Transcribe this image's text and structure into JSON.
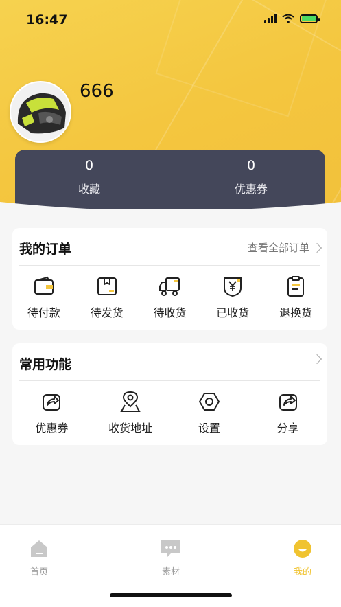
{
  "status_bar": {
    "time": "16:47"
  },
  "profile": {
    "username": "666"
  },
  "stats": [
    {
      "value": "0",
      "label": "收藏"
    },
    {
      "value": "0",
      "label": "优惠券"
    }
  ],
  "orders": {
    "title": "我的订单",
    "view_all": "查看全部订单",
    "items": [
      {
        "label": "待付款",
        "icon": "wallet-icon"
      },
      {
        "label": "待发货",
        "icon": "package-icon"
      },
      {
        "label": "待收货",
        "icon": "truck-icon"
      },
      {
        "label": "已收货",
        "icon": "yen-shield-icon"
      },
      {
        "label": "退换货",
        "icon": "clipboard-icon"
      }
    ]
  },
  "functions": {
    "title": "常用功能",
    "items": [
      {
        "label": "优惠券",
        "icon": "share-icon"
      },
      {
        "label": "收货地址",
        "icon": "location-pin-icon"
      },
      {
        "label": "设置",
        "icon": "settings-hexagon-icon"
      },
      {
        "label": "分享",
        "icon": "share-icon"
      }
    ]
  },
  "tabbar": {
    "items": [
      {
        "label": "首页",
        "icon": "home-icon",
        "active": false
      },
      {
        "label": "素材",
        "icon": "chat-icon",
        "active": false
      },
      {
        "label": "我的",
        "icon": "profile-face-icon",
        "active": true
      }
    ]
  },
  "colors": {
    "accent": "#f4c63f",
    "stats_bg": "#44475a",
    "active_tab": "#f0c330"
  }
}
